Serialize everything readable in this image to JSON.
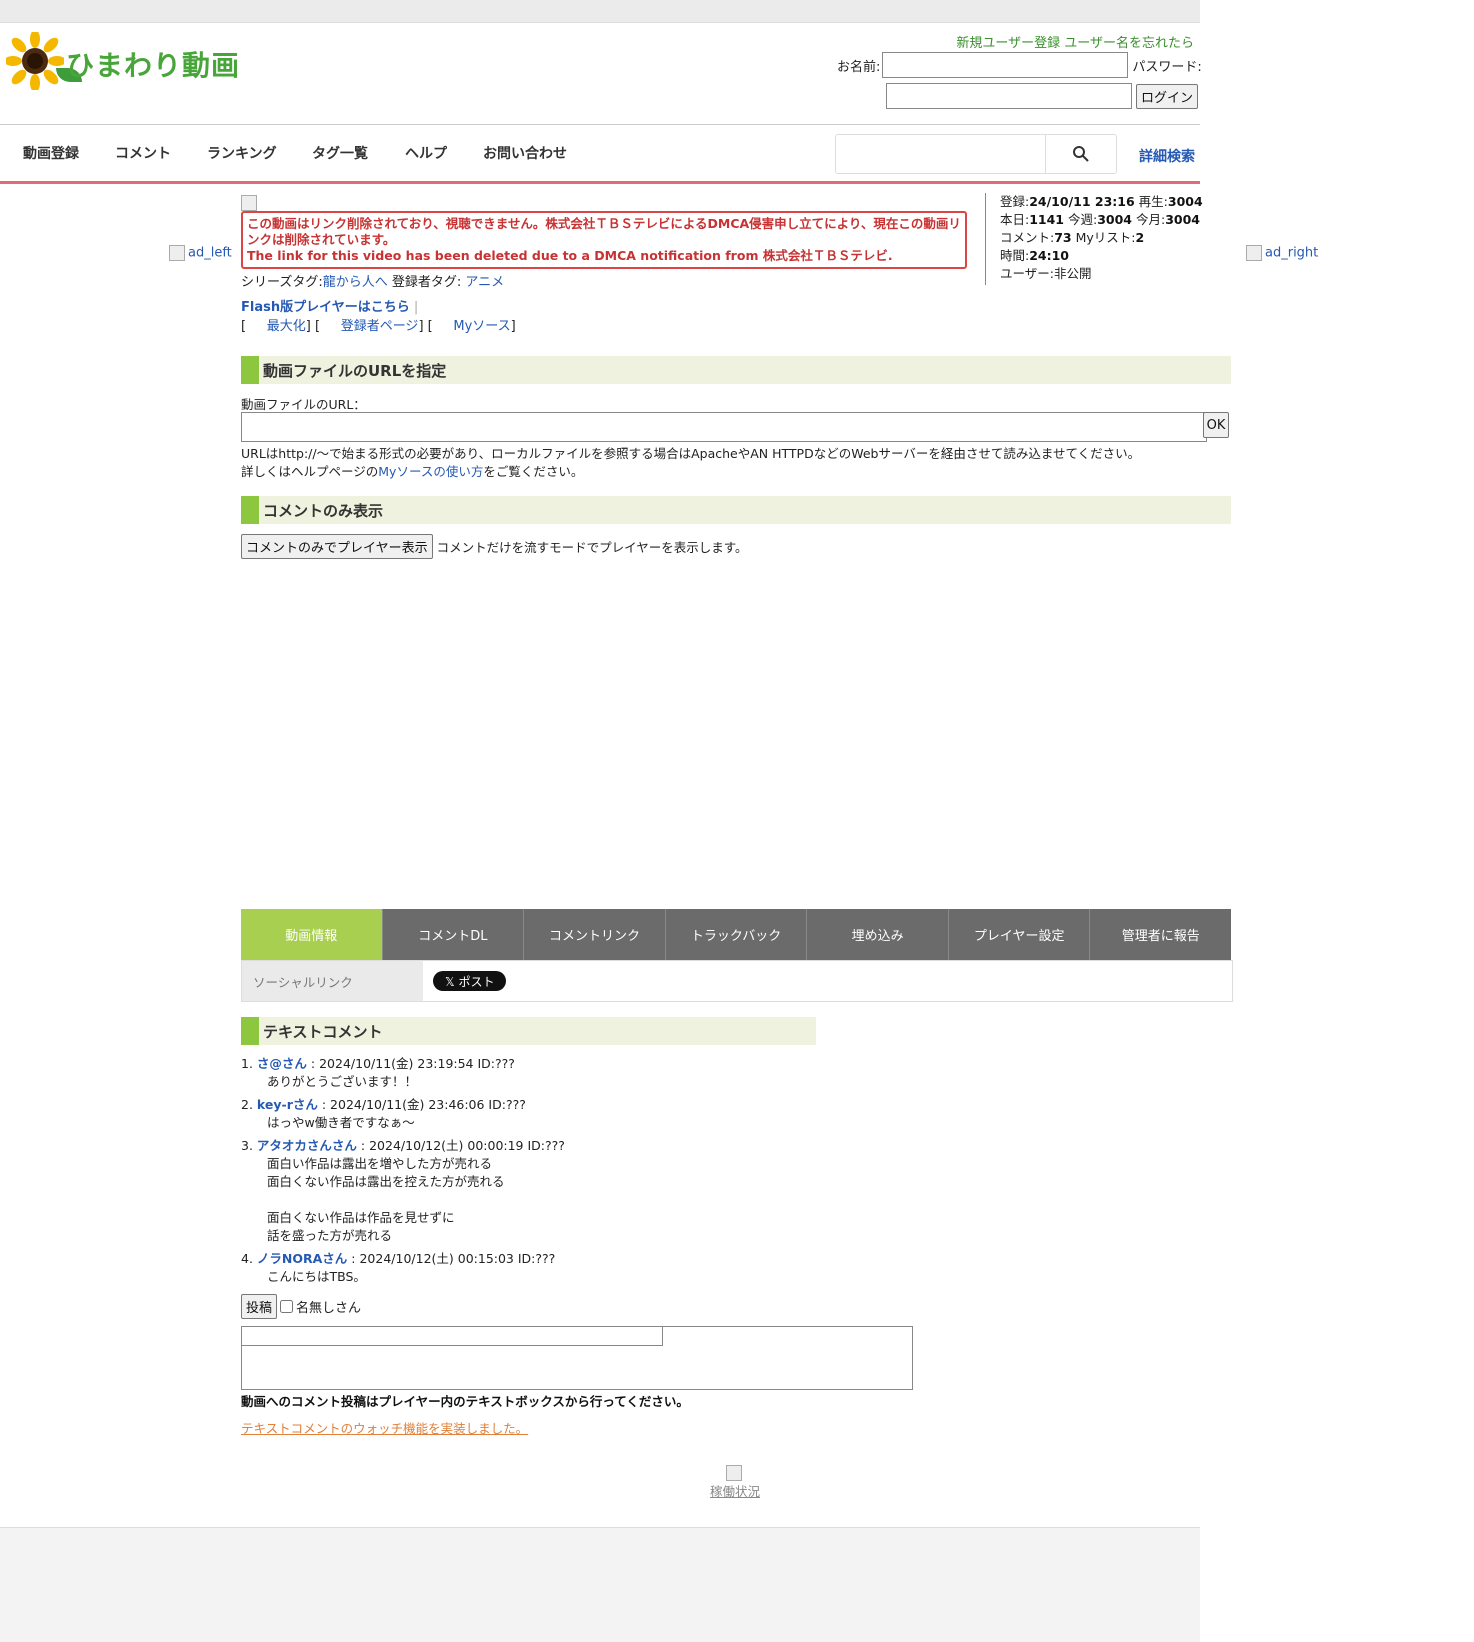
{
  "header": {
    "logo_text": "ひまわり動画",
    "register_link": "新規ユーザー登録",
    "forgot_link": "ユーザー名を忘れたら",
    "name_label": "お名前:",
    "password_label": "パスワード:",
    "login_button": "ログイン"
  },
  "nav": {
    "items": [
      "動画登録",
      "コメント",
      "ランキング",
      "タグ一覧",
      "ヘルプ",
      "お問い合わせ"
    ],
    "advanced_search": "詳細検索"
  },
  "ads": {
    "left_alt": "ad_left",
    "right_alt": "ad_right"
  },
  "notice": {
    "jp": "この動画はリンク削除されており、視聴できません。株式会社ＴＢＳテレビによるDMCA侵害申し立てにより、現在この動画リンクは削除されています。",
    "en": "The link for this video has been deleted due to a DMCA notification from 株式会社ＴＢＳテレビ."
  },
  "video_info": {
    "registered_label": "登録:",
    "registered": "24/10/11 23:16",
    "plays_label": "再生:",
    "plays": "3004",
    "today_label": "本日:",
    "today": "1141",
    "week_label": "今週:",
    "week": "3004",
    "month_label": "今月:",
    "month": "3004",
    "comments_label": "コメント:",
    "comments": "73",
    "mylist_label": "Myリスト:",
    "mylist": "2",
    "duration_label": "時間:",
    "duration": "24:10",
    "user_text": "ユーザー:非公開"
  },
  "tags": {
    "series_label": "シリーズタグ:",
    "series_tag": "龍から人へ",
    "registrant_label": "登録者タグ:",
    "registrant_tag": "アニメ"
  },
  "links": {
    "flash": "Flash版プレイヤーはこちら",
    "maximize": "最大化",
    "registrant_page": "登録者ページ",
    "mysource": "Myソース"
  },
  "url_section": {
    "title": "動画ファイルのURLを指定",
    "label": "動画ファイルのURL：",
    "ok": "OK",
    "note1": "URLはhttp://～で始まる形式の必要があり、ローカルファイルを参照する場合はApacheやAN HTTPDなどのWebサーバーを経由させて読み込ませてください。",
    "note2_pre": "詳しくはヘルプページの",
    "note2_link": "Myソースの使い方",
    "note2_post": "をご覧ください。"
  },
  "comment_only": {
    "title": "コメントのみ表示",
    "button": "コメントのみでプレイヤー表示",
    "desc": "コメントだけを流すモードでプレイヤーを表示します。"
  },
  "tabs": [
    "動画情報",
    "コメントDL",
    "コメントリンク",
    "トラックバック",
    "埋め込み",
    "プレイヤー設定",
    "管理者に報告"
  ],
  "social": {
    "label": "ソーシャルリンク",
    "x_post": "𝕏 ポスト"
  },
  "text_comments": {
    "title": "テキストコメント",
    "items": [
      {
        "num": "1.",
        "name": "さ@さん",
        "meta": " : 2024/10/11(金) 23:19:54 ID:???",
        "body": "ありがとうございます！！"
      },
      {
        "num": "2.",
        "name": "key-rさん",
        "meta": " : 2024/10/11(金) 23:46:06 ID:???",
        "body": "はっやw働き者ですなぁ〜"
      },
      {
        "num": "3.",
        "name": "アタオカさんさん",
        "meta": " : 2024/10/12(土) 00:00:19 ID:???",
        "body": "面白い作品は露出を増やした方が売れる\n面白くない作品は露出を控えた方が売れる\n\n面白くない作品は作品を見せずに\n話を盛った方が売れる"
      },
      {
        "num": "4.",
        "name": "ノラNORAさん",
        "meta": " : 2024/10/12(土) 00:15:03 ID:???",
        "body": "こんにちはTBS。"
      }
    ],
    "post_button": "投稿",
    "anonymous_label": "名無しさん",
    "post_note": "動画へのコメント投稿はプレイヤー内のテキストボックスから行ってください。",
    "watch_link": "テキストコメントのウォッチ機能を実装しました。"
  },
  "footer": {
    "status_link": "稼働状況"
  },
  "colors": {
    "nav_underline": "#e06b7a",
    "tab_active": "#a8cf4f",
    "tab_bg": "#6b6b6b",
    "section_bar": "#8dc63f",
    "notice_red": "#c83232"
  }
}
